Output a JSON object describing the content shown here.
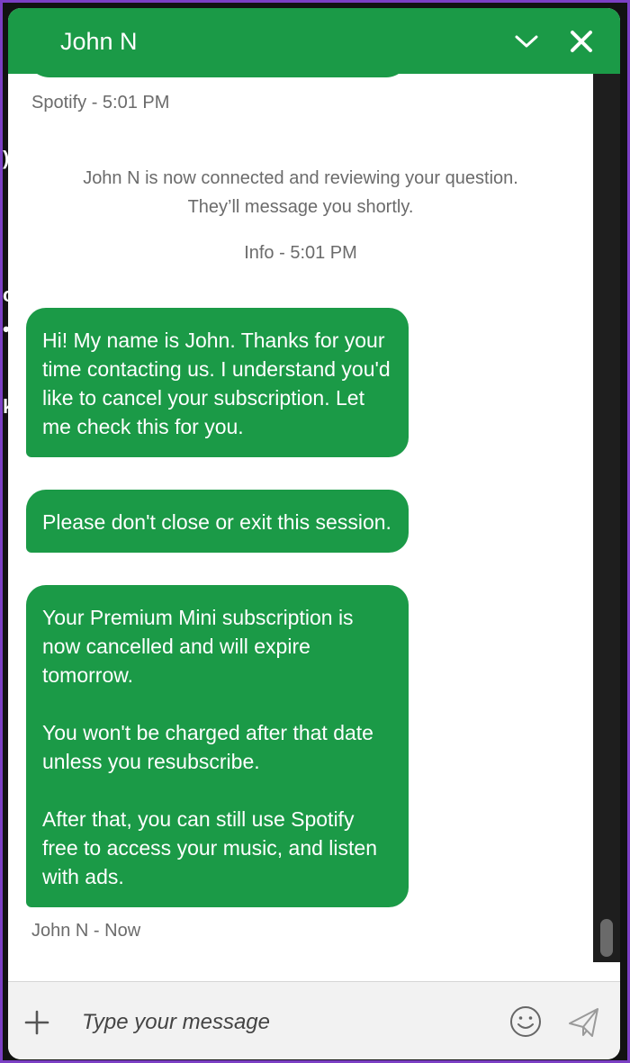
{
  "header": {
    "title": "John N"
  },
  "messages": {
    "previous_meta": "Spotify - 5:01 PM",
    "system_text": "John N is now connected and reviewing your question. They’ll message you shortly.",
    "system_meta": "Info - 5:01 PM",
    "bubbles": [
      "Hi! My name is John. Thanks for your time contacting us. I understand you'd like to cancel your subscription. Let me check this for you.",
      "Please don't close or exit this session.",
      "Your Premium Mini subscription is now cancelled and will expire tomorrow.\n\nYou won't be charged after that date unless you resubscribe.\n\nAfter that, you can still use Spotify free to access your music, and listen with ads."
    ],
    "last_meta": "John N - Now"
  },
  "input": {
    "placeholder": "Type your message"
  },
  "icons": {
    "minimize": "chevron-down-icon",
    "close": "close-icon",
    "attach": "plus-icon",
    "emoji": "smiley-icon",
    "send": "paper-plane-icon"
  },
  "colors": {
    "accent": "#1b9a47",
    "frame": "#7b3fc4"
  }
}
